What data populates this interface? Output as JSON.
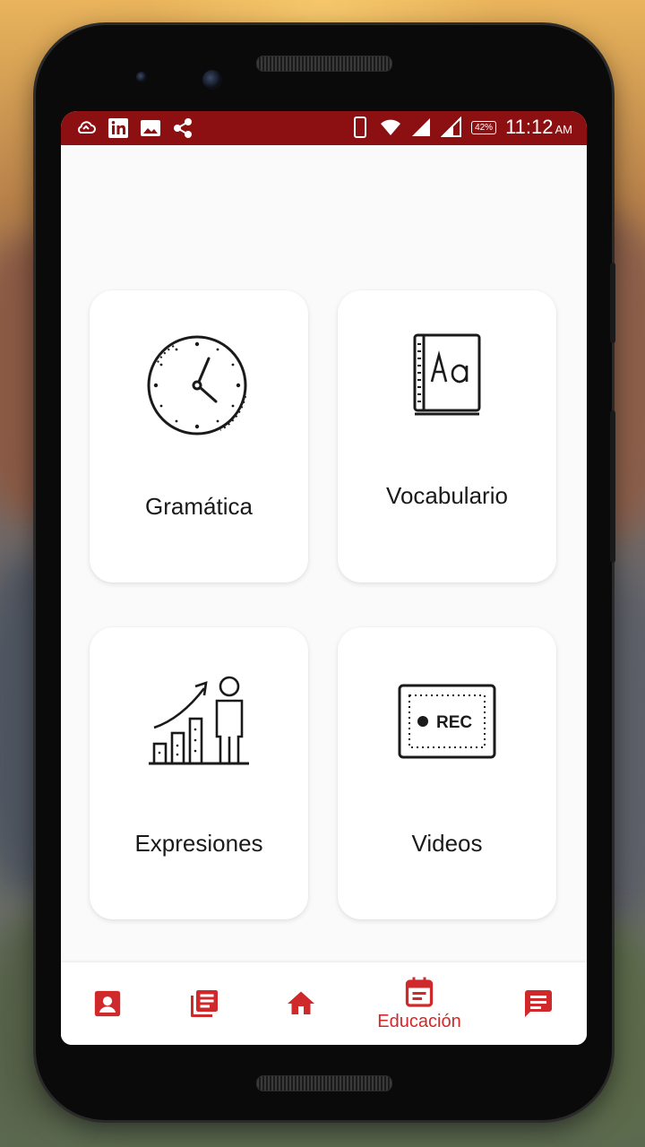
{
  "status_bar": {
    "time": "11:12",
    "am_pm": "AM",
    "battery": "42%"
  },
  "cards": [
    {
      "label": "Gramática",
      "icon": "clock-icon"
    },
    {
      "label": "Vocabulario",
      "icon": "dictionary-icon"
    },
    {
      "label": "Expresiones",
      "icon": "growth-chart-icon"
    },
    {
      "label": "Videos",
      "icon": "rec-icon"
    }
  ],
  "bottom_nav": {
    "items": [
      {
        "icon": "profile-icon",
        "label": ""
      },
      {
        "icon": "library-icon",
        "label": ""
      },
      {
        "icon": "home-icon",
        "label": ""
      },
      {
        "icon": "calendar-icon",
        "label": "Educación",
        "active": true
      },
      {
        "icon": "chat-icon",
        "label": ""
      }
    ]
  },
  "colors": {
    "status_bar": "#8c0f12",
    "accent": "#d0292c",
    "card_bg": "#ffffff",
    "screen_bg": "#fafafa"
  }
}
